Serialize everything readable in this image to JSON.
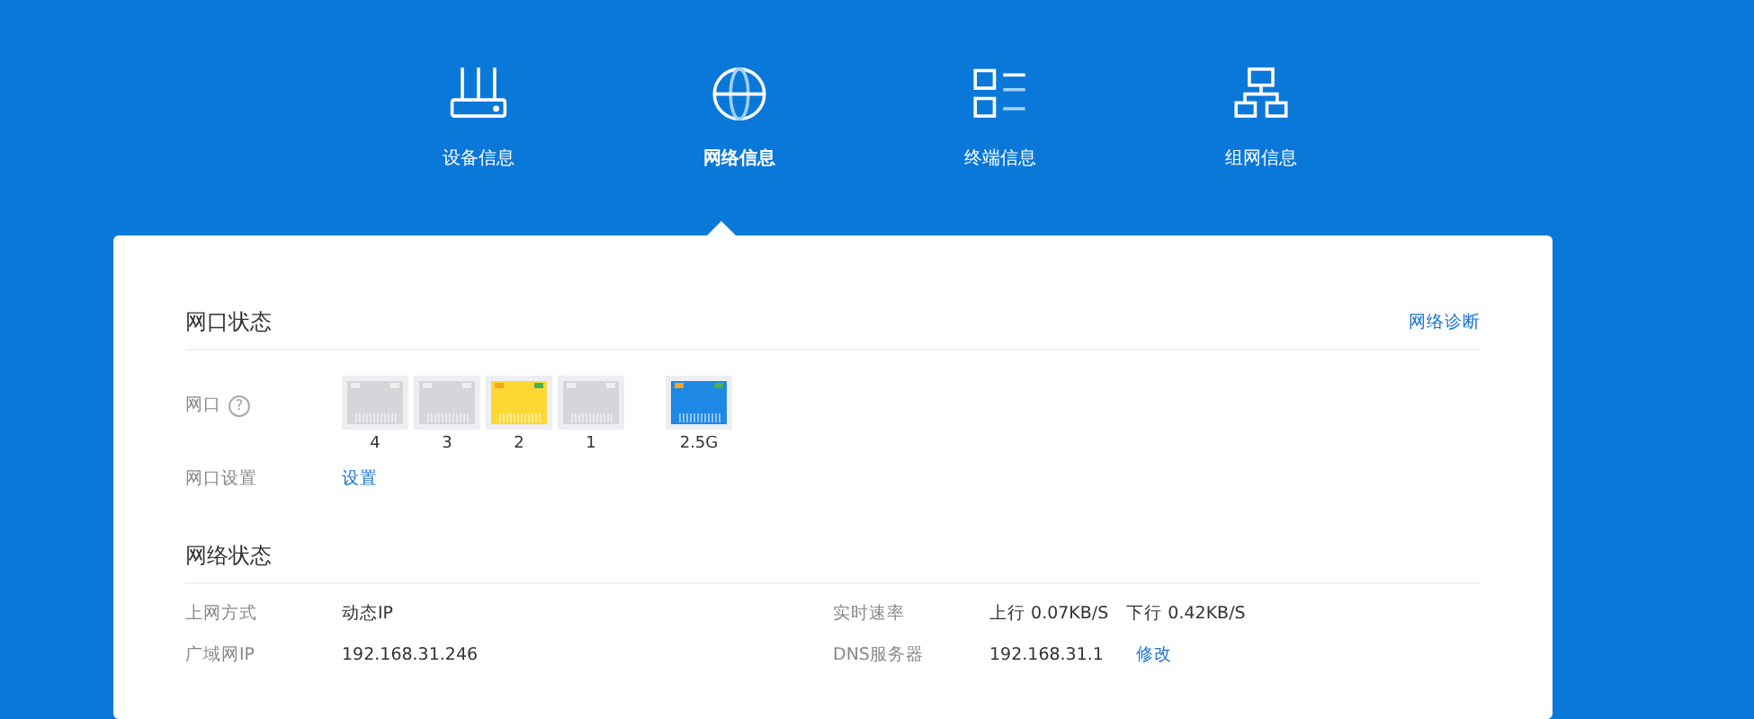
{
  "nav": [
    {
      "label": "设备信息",
      "kind": "router",
      "selected": false
    },
    {
      "label": "网络信息",
      "kind": "globe",
      "selected": true
    },
    {
      "label": "终端信息",
      "kind": "list",
      "selected": false
    },
    {
      "label": "组网信息",
      "kind": "mesh",
      "selected": false
    }
  ],
  "port_section": {
    "title": "网口状态",
    "link": "网络诊断",
    "port_label": "网口",
    "help_icon": "?",
    "ports": [
      {
        "label": "4",
        "color": "#d4d6da",
        "kind": "lan"
      },
      {
        "label": "3",
        "color": "#d4d6da",
        "kind": "lan"
      },
      {
        "label": "2",
        "color": "#fdd835",
        "kind": "lan"
      },
      {
        "label": "1",
        "color": "#d4d6da",
        "kind": "lan"
      },
      {
        "label": "2.5G",
        "color": "#1e88e5",
        "kind": "wan"
      }
    ],
    "settings_label": "网口设置",
    "settings_link": "设置"
  },
  "network_section": {
    "title": "网络状态",
    "rows": [
      {
        "label": "上网方式",
        "value": "动态IP",
        "label_2": "实时速率",
        "value_2": "上行 0.07KB/S　下行 0.42KB/S"
      },
      {
        "label": "广域网IP",
        "value": "192.168.31.246",
        "label_2": "DNS服务器",
        "value_2": "192.168.31.1",
        "link_2": "修改"
      }
    ]
  }
}
